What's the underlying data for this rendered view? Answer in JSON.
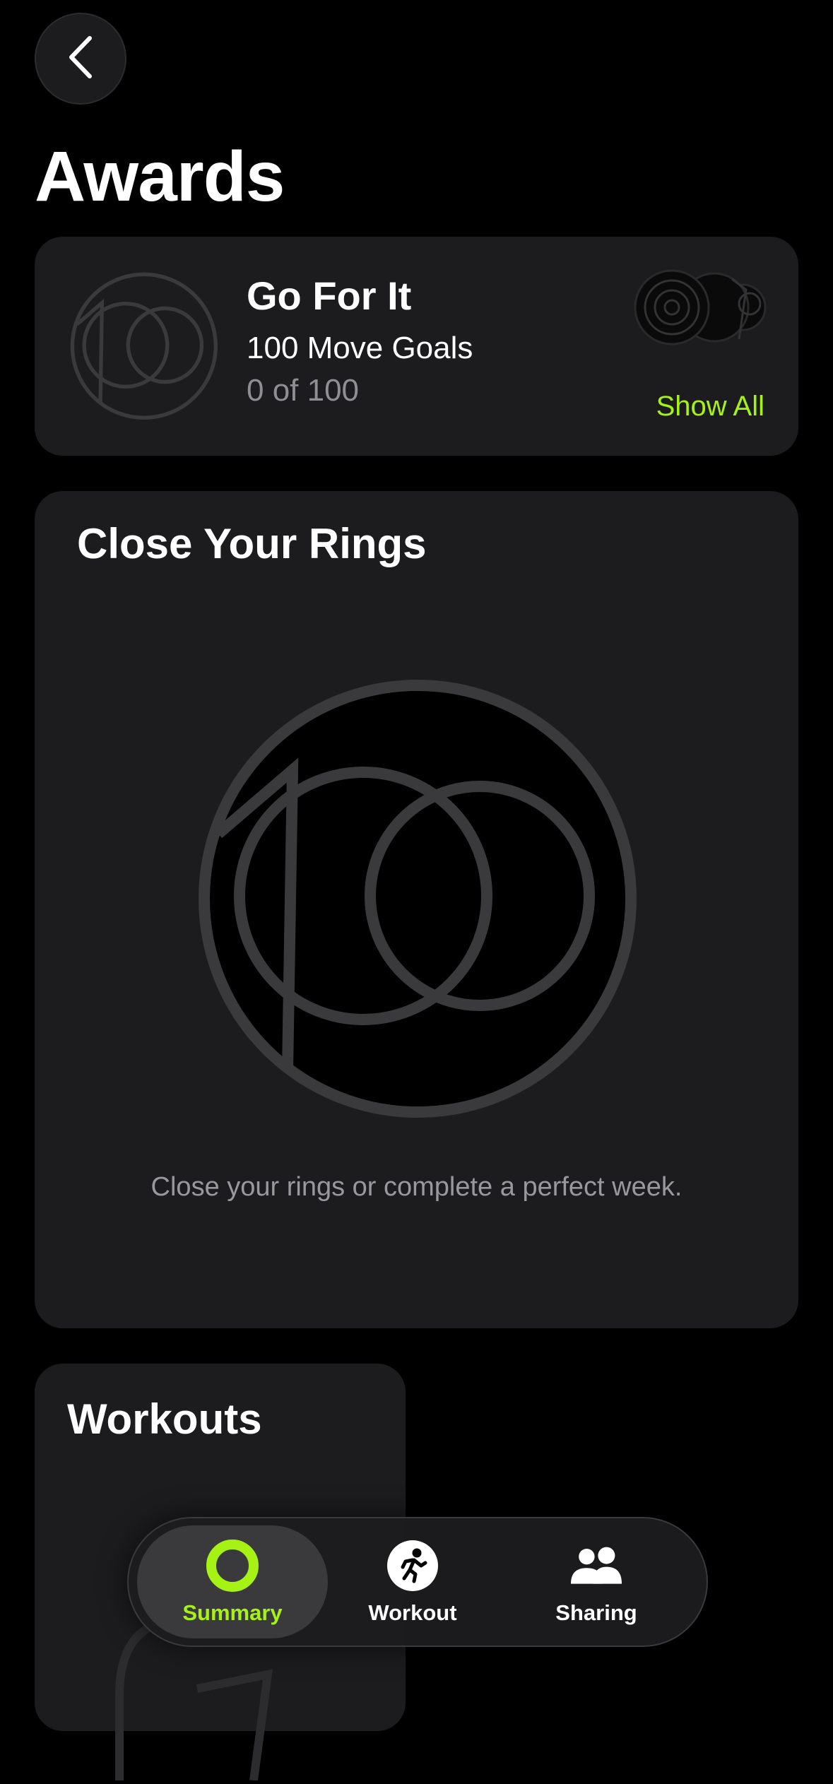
{
  "header": {
    "back_icon": "chevron-left-icon",
    "title": "Awards"
  },
  "featured_award": {
    "badge_icon": "100-move-goals-badge-icon",
    "title": "Go For It",
    "subtitle": "100 Move Goals",
    "progress": "0 of 100",
    "progress_value": 0,
    "progress_total": 100,
    "stack_icon": "award-stack-icon",
    "show_all_label": "Show All"
  },
  "close_rings_section": {
    "title": "Close Your Rings",
    "badge_icon": "100-move-goals-badge-icon",
    "description": "Close your rings or complete a perfect week."
  },
  "workouts_section": {
    "title": "Workouts"
  },
  "tabbar": {
    "tabs": [
      {
        "label": "Summary",
        "icon": "activity-ring-icon",
        "active": true
      },
      {
        "label": "Workout",
        "icon": "running-figure-icon",
        "active": false
      },
      {
        "label": "Sharing",
        "icon": "people-icon",
        "active": false
      }
    ]
  },
  "colors": {
    "background": "#000000",
    "card": "#1c1c1e",
    "accent": "#a6f214",
    "secondary_text": "#8e8e93",
    "badge_stroke": "#3a3a3c"
  }
}
